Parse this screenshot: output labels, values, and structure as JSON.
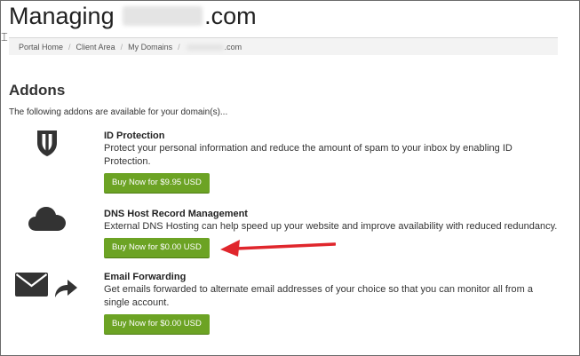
{
  "header": {
    "title_prefix": "Managing ",
    "title_suffix": ".com"
  },
  "breadcrumb": {
    "items": [
      "Portal Home",
      "Client Area",
      "My Domains"
    ],
    "last_suffix": ".com"
  },
  "addons_section": {
    "title": "Addons",
    "intro": "The following addons are available for your domain(s)..."
  },
  "addons": [
    {
      "name": "ID Protection",
      "description": "Protect your personal information and reduce the amount of spam to your inbox by enabling ID Protection.",
      "button": "Buy Now for $9.95 USD",
      "icon": "shield-icon"
    },
    {
      "name": "DNS Host Record Management",
      "description": "External DNS Hosting can help speed up your website and improve availability with reduced redundancy.",
      "button": "Buy Now for $0.00 USD",
      "icon": "cloud-icon"
    },
    {
      "name": "Email Forwarding",
      "description": "Get emails forwarded to alternate email addresses of your choice so that you can monitor all from a single account.",
      "button": "Buy Now for $0.00 USD",
      "icon": "envelope-forward-icon"
    }
  ],
  "colors": {
    "button_green": "#6ca324",
    "annotation_arrow": "#e0262c"
  }
}
